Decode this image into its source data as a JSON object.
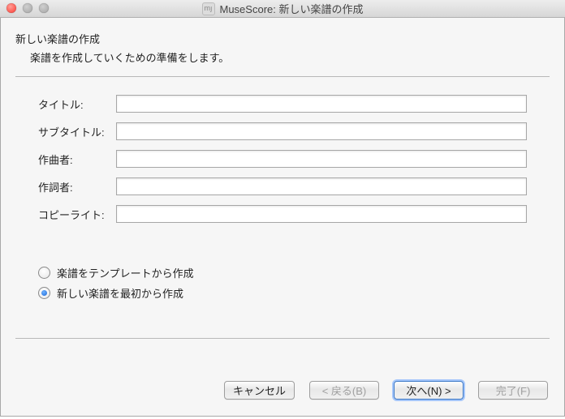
{
  "window": {
    "title": "MuseScore: 新しい楽譜の作成",
    "app_icon_text": "mյ"
  },
  "wizard": {
    "heading": "新しい楽譜の作成",
    "sub": "楽譜を作成していくための準備をします。"
  },
  "fields": {
    "title_label": "タイトル",
    "title_value": "",
    "subtitle_label": "サブタイトル",
    "subtitle_value": "",
    "composer_label": "作曲者",
    "composer_value": "",
    "lyricist_label": "作詞者",
    "lyricist_value": "",
    "copyright_label": "コピーライト",
    "copyright_value": ""
  },
  "options": {
    "from_template_label": "楽譜をテンプレートから作成",
    "from_scratch_label": "新しい楽譜を最初から作成",
    "selected": "from_scratch"
  },
  "buttons": {
    "cancel": "キャンセル",
    "back": "< 戻る(B)",
    "next": "次へ(N) >",
    "finish": "完了(F)"
  },
  "colon": ":"
}
